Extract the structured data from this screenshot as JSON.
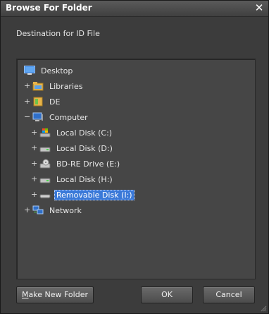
{
  "window": {
    "title": "Browse For Folder",
    "close_label": "✕"
  },
  "prompt": "Destination for ID File",
  "tree": {
    "items": [
      {
        "label": "Desktop",
        "expander": "",
        "icon": "desktop-icon",
        "selected": false
      },
      {
        "label": "Libraries",
        "expander": "+",
        "icon": "libraries-icon",
        "selected": false
      },
      {
        "label": "DE",
        "expander": "+",
        "icon": "user-folder-icon",
        "selected": false
      },
      {
        "label": "Computer",
        "expander": "−",
        "icon": "computer-icon",
        "selected": false
      },
      {
        "label": "Local Disk (C:)",
        "expander": "+",
        "icon": "system-drive-icon",
        "selected": false
      },
      {
        "label": "Local Disk (D:)",
        "expander": "+",
        "icon": "hard-drive-icon",
        "selected": false
      },
      {
        "label": "BD-RE Drive (E:)",
        "expander": "+",
        "icon": "optical-drive-icon",
        "selected": false
      },
      {
        "label": "Local Disk (H:)",
        "expander": "+",
        "icon": "hard-drive-icon",
        "selected": false
      },
      {
        "label": "Removable Disk (I:)",
        "expander": "+",
        "icon": "removable-drive-icon",
        "selected": true
      },
      {
        "label": "Network",
        "expander": "+",
        "icon": "network-icon",
        "selected": false
      }
    ]
  },
  "buttons": {
    "make_new_folder": {
      "accel": "M",
      "rest": "ake New Folder"
    },
    "ok": "OK",
    "cancel": "Cancel"
  },
  "colors": {
    "selection": "#3a79d8",
    "background": "#3c3c3c",
    "panel": "#464646"
  }
}
